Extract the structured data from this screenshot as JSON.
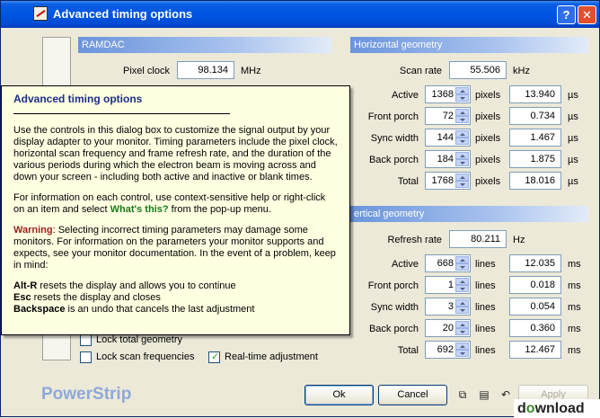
{
  "window": {
    "title": "Advanced timing options",
    "help_button": "?",
    "close_button": "✕"
  },
  "ramdac": {
    "header": "RAMDAC",
    "pixel_clock_label": "Pixel clock",
    "pixel_clock_value": "98.134",
    "pixel_clock_unit": "MHz"
  },
  "horizontal": {
    "header": "Horizontal geometry",
    "scan_rate_label": "Scan rate",
    "scan_rate_value": "55.506",
    "scan_rate_unit": "kHz",
    "rows": [
      {
        "label": "Active",
        "value": "1368",
        "unit": "pixels",
        "time": "13.940",
        "time_unit": "µs"
      },
      {
        "label": "Front porch",
        "value": "72",
        "unit": "pixels",
        "time": "0.734",
        "time_unit": "µs"
      },
      {
        "label": "Sync width",
        "value": "144",
        "unit": "pixels",
        "time": "1.467",
        "time_unit": "µs"
      },
      {
        "label": "Back porch",
        "value": "184",
        "unit": "pixels",
        "time": "1.875",
        "time_unit": "µs"
      },
      {
        "label": "Total",
        "value": "1768",
        "unit": "pixels",
        "time": "18.016",
        "time_unit": "µs"
      }
    ]
  },
  "vertical": {
    "header": "ertical geometry",
    "refresh_label": "Refresh rate",
    "refresh_value": "80.211",
    "refresh_unit": "Hz",
    "rows": [
      {
        "label": "Active",
        "value": "668",
        "unit": "lines",
        "time": "12.035",
        "time_unit": "ms"
      },
      {
        "label": "Front porch",
        "value": "1",
        "unit": "lines",
        "time": "0.018",
        "time_unit": "ms"
      },
      {
        "label": "Sync width",
        "value": "3",
        "unit": "lines",
        "time": "0.054",
        "time_unit": "ms"
      },
      {
        "label": "Back porch",
        "value": "20",
        "unit": "lines",
        "time": "0.360",
        "time_unit": "ms"
      },
      {
        "label": "Total",
        "value": "692",
        "unit": "lines",
        "time": "12.467",
        "time_unit": "ms"
      }
    ]
  },
  "options": {
    "lock_total_geometry": {
      "label": "Lock total geometry",
      "checked": false
    },
    "lock_scan_frequencies": {
      "label": "Lock scan frequencies",
      "checked": false
    },
    "realtime_adjustment": {
      "label": "Real-time adjustment",
      "checked": true,
      "mark": "✓"
    }
  },
  "footer": {
    "brand": "PowerStrip",
    "ok": "Ok",
    "cancel": "Cancel",
    "apply": "Apply",
    "copy_icon": "⧉",
    "paste_icon": "▤",
    "undo_icon": "↶"
  },
  "tooltip": {
    "title": "Advanced timing options",
    "p1": "Use the controls in this dialog box to customize the signal output by your display adapter to your monitor. Timing parameters include the pixel clock, horizontal scan frequency and frame refresh rate, and the duration of the various periods during which the electron beam is moving across and down your screen - including both active and inactive or blank times.",
    "p2_a": "For information on each control, use context-sensitive help or right-click on an item and select ",
    "p2_link": "What's this?",
    "p2_b": " from the pop-up menu.",
    "warn_label": "Warning",
    "warn_text": ": Selecting incorrect timing parameters may damage some monitors. For information on the parameters your monitor supports and expects, see your monitor documentation. In the event of a problem, keep in mind:",
    "keys": [
      {
        "key": "Alt-R",
        "text": " resets the display and allows you to continue"
      },
      {
        "key": "Esc",
        "text": " resets the display and closes"
      },
      {
        "key": "Backspace",
        "text": " is an undo that cancels the last adjustment"
      }
    ]
  },
  "watermark": {
    "prefix": "d",
    "o": "o",
    "suffix": "wnload"
  }
}
